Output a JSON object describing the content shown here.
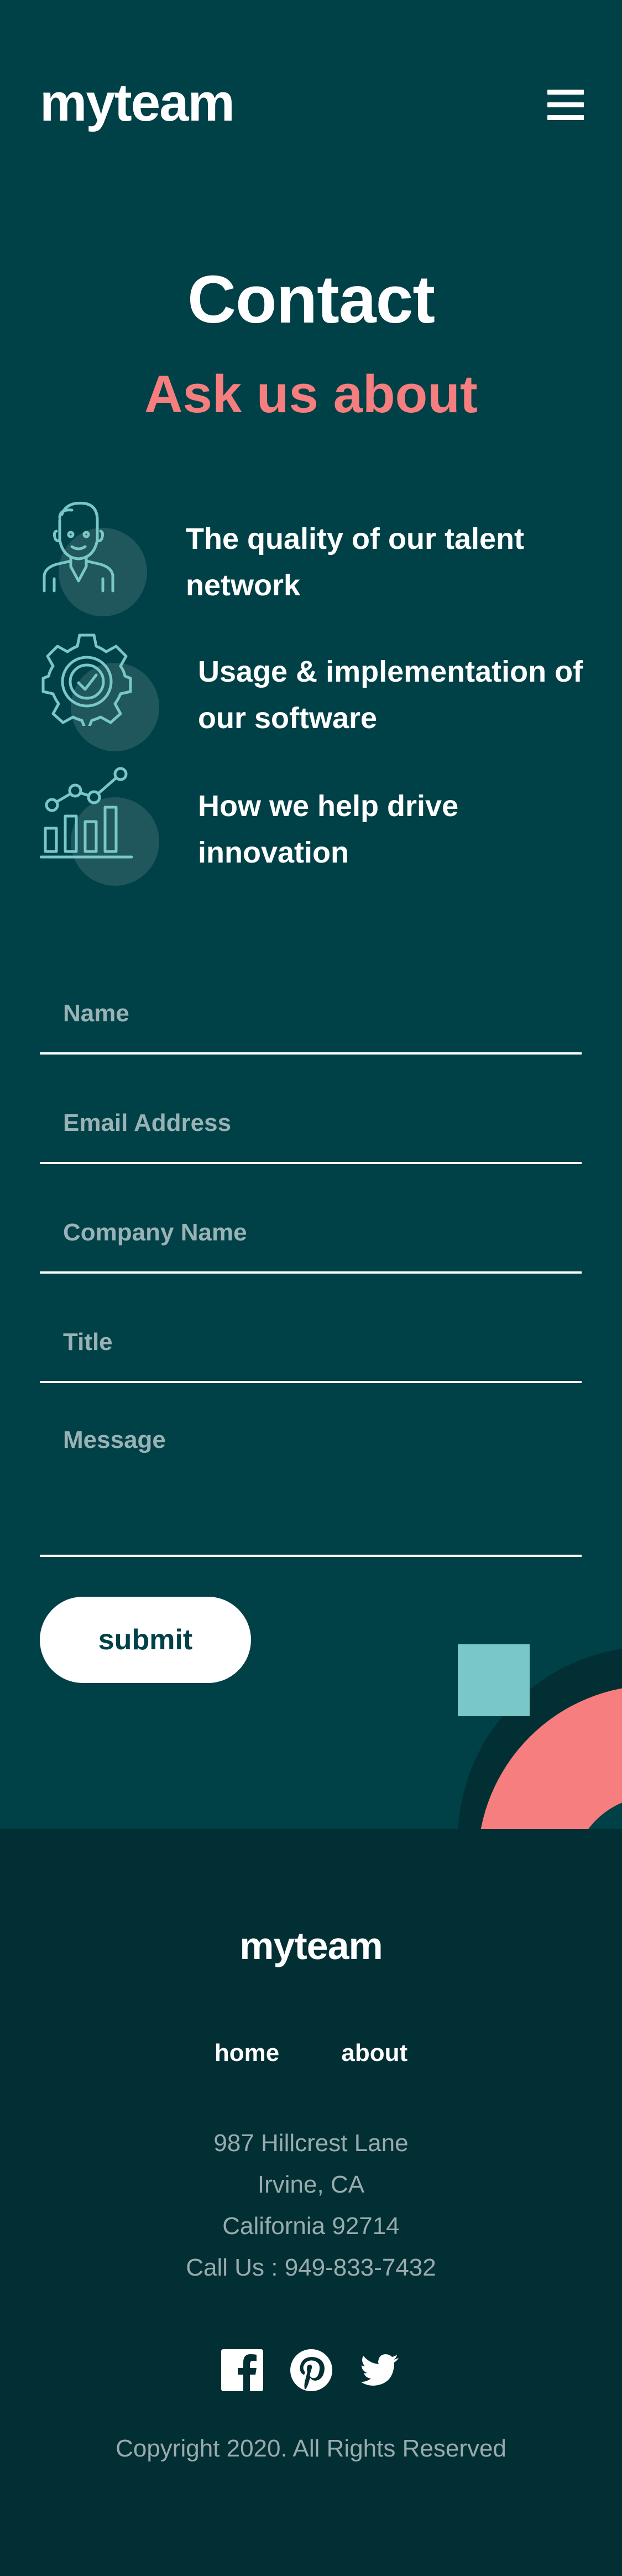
{
  "header": {
    "logo": "myteam",
    "menu_icon": "hamburger-menu-icon"
  },
  "main": {
    "title": "Contact",
    "subtitle": "Ask us about",
    "features": [
      {
        "icon": "person-icon",
        "text": "The quality of our talent network"
      },
      {
        "icon": "gear-check-icon",
        "text": "Usage & implementation of our software"
      },
      {
        "icon": "chart-growth-icon",
        "text": "How we help drive innovation"
      }
    ]
  },
  "form": {
    "name_placeholder": "Name",
    "email_placeholder": "Email Address",
    "company_placeholder": "Company Name",
    "title_placeholder": "Title",
    "message_placeholder": "Message",
    "submit_label": "submit"
  },
  "footer": {
    "logo": "myteam",
    "nav": [
      "home",
      "about"
    ],
    "address": [
      "987 Hillcrest Lane",
      "Irvine, CA",
      "California 92714",
      "Call Us : 949-833-7432"
    ],
    "social": [
      "facebook-icon",
      "pinterest-icon",
      "twitter-icon"
    ],
    "copyright": "Copyright 2020. All Rights Reserved"
  },
  "colors": {
    "primary_bg": "#004047",
    "footer_bg": "#012f34",
    "accent_coral": "#f67e7e",
    "accent_teal": "#79c8c7",
    "text": "#ffffff"
  }
}
